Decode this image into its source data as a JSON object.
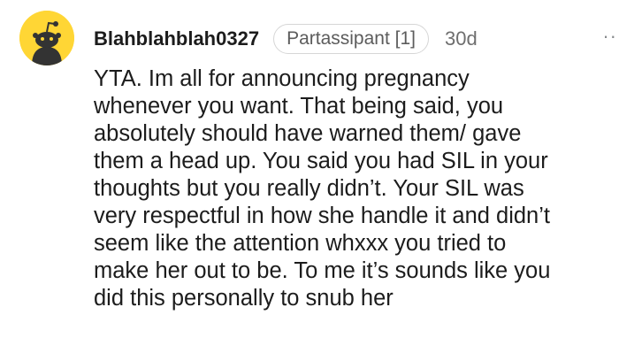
{
  "comment": {
    "avatar_icon": "reddit-snoo-avatar-icon",
    "avatar_color": "#ffd635",
    "username": "Blahblahblah0327",
    "flair": "Partassipant [1]",
    "age": "30d",
    "more_icon": "ellipsis-icon",
    "more_glyph": "··",
    "body_lines": [
      "YTA. Im all for announcing pregnancy",
      "whenever you want. That being said, you",
      "absolutely should have warned them/ gave",
      "them a head up. You said you had SIL in your",
      "thoughts but you really didn’t. Your SIL was",
      "very respectful in how she handle it and didn’t",
      "seem like the attention whxxx you tried to",
      "make her out to be. To me it’s sounds like you",
      "did this personally to snub her"
    ]
  }
}
